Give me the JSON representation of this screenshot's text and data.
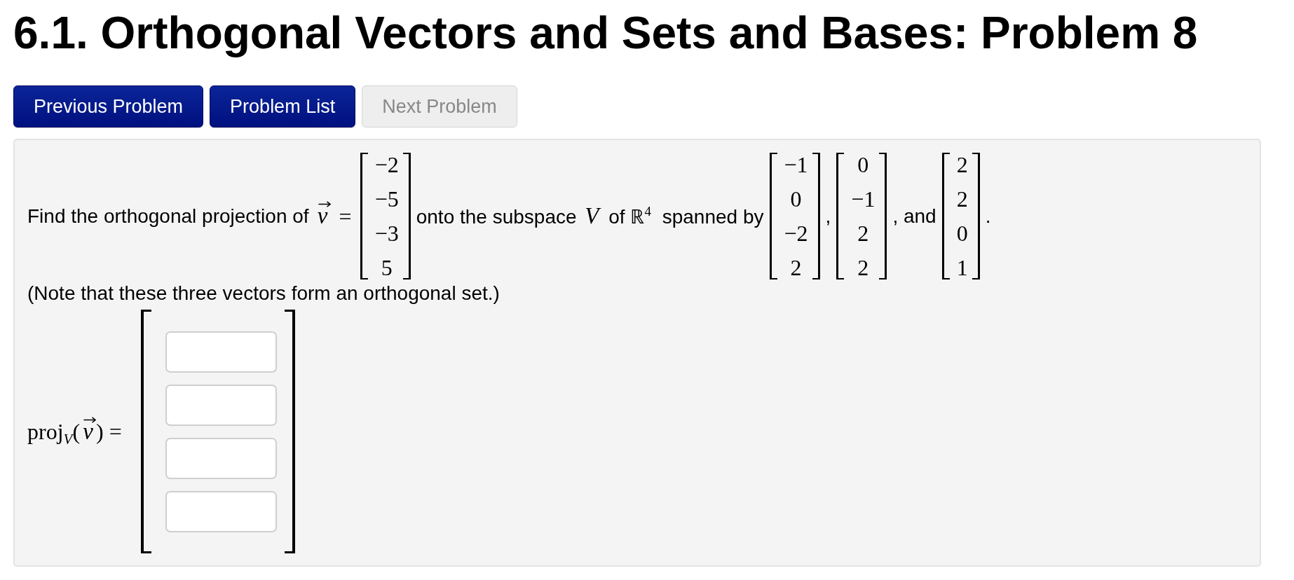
{
  "title": "6.1. Orthogonal Vectors and Sets and Bases: Problem 8",
  "nav_buttons": [
    {
      "label": "Previous Problem",
      "disabled": false
    },
    {
      "label": "Problem List",
      "disabled": false
    },
    {
      "label": "Next Problem",
      "disabled": true
    }
  ],
  "problem": {
    "statement": [
      {
        "kind": "text",
        "text": "Find the orthogonal projection of"
      },
      {
        "kind": "vector",
        "text": "v"
      },
      {
        "kind": "math",
        "text": "="
      },
      {
        "kind": "matrix",
        "entries": [
          "−2",
          "−5",
          "−3",
          "5"
        ]
      },
      {
        "kind": "text",
        "text": "onto the subspace *V* of ℝ$^{4}$ spanned by"
      },
      {
        "kind": "matrix",
        "entries": [
          "−1",
          "0",
          "−2",
          "2"
        ]
      },
      {
        "kind": "text",
        "text": ","
      },
      {
        "kind": "matrix",
        "entries": [
          "0",
          "−1",
          "2",
          "2"
        ]
      },
      {
        "kind": "text",
        "text": ", and"
      },
      {
        "kind": "matrix",
        "entries": [
          "2",
          "2",
          "0",
          "1"
        ]
      },
      {
        "kind": "text",
        "text": "."
      }
    ],
    "note": "(Note that these three vectors form an orthogonal set.)",
    "answer": {
      "label": [
        {
          "kind": "math",
          "text": "proj$_{V}$("
        },
        {
          "kind": "vector",
          "text": "v"
        },
        {
          "kind": "math",
          "text": ") ="
        }
      ],
      "fields": [
        {
          "disabled": false
        },
        {
          "disabled": false
        },
        {
          "disabled": false
        },
        {
          "disabled": false
        }
      ]
    }
  }
}
